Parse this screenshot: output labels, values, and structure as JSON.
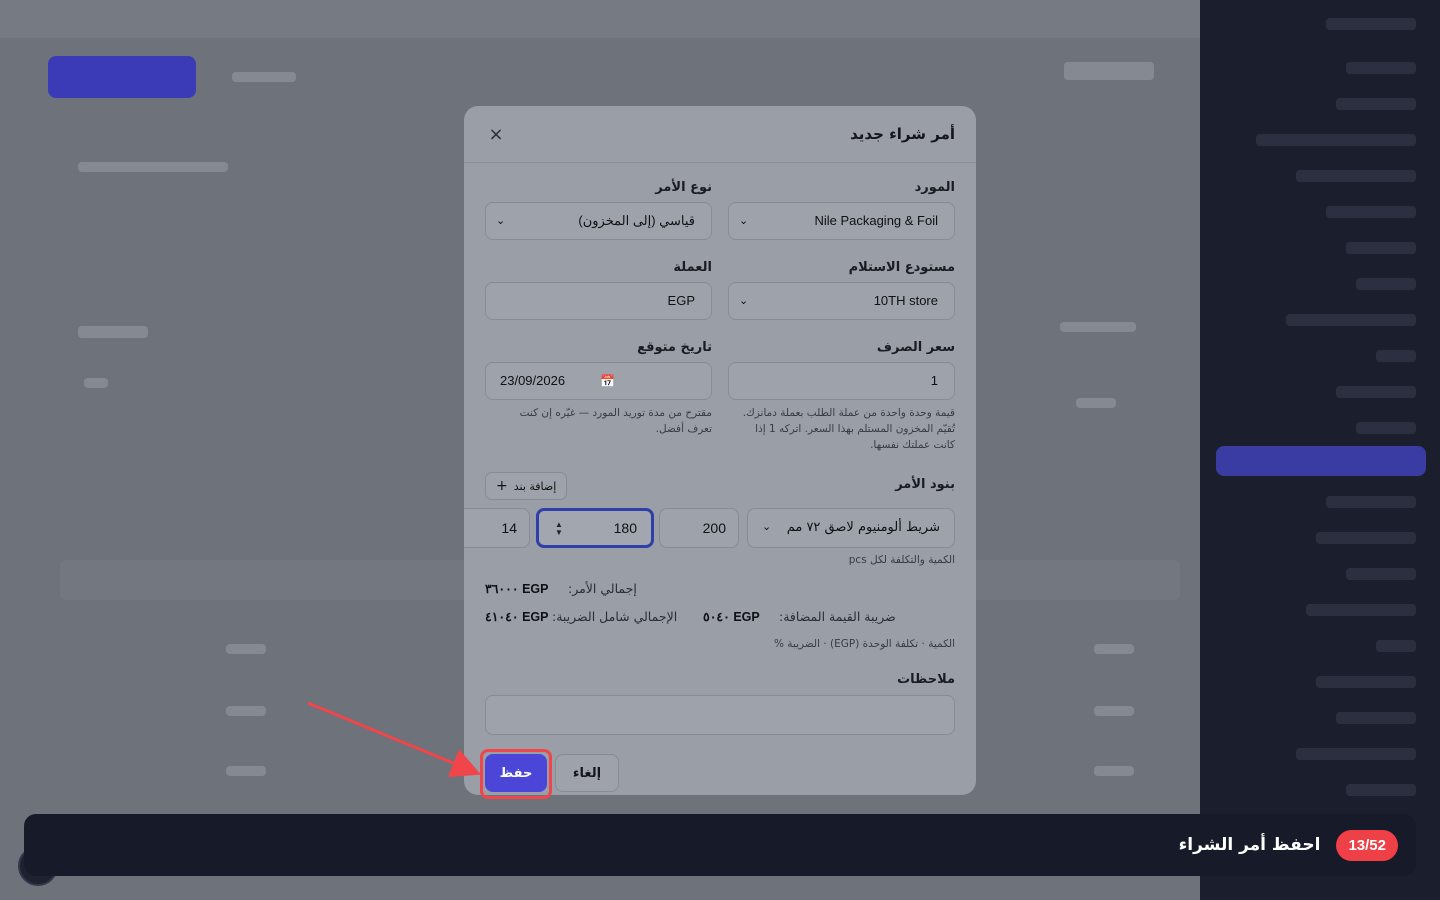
{
  "modal": {
    "title": "أمر شراء جديد",
    "close_symbol": "×",
    "supplier": {
      "label": "المورد",
      "value": "Nile Packaging & Foil"
    },
    "order_type": {
      "label": "نوع الأمر",
      "value": "قياسي (إلى المخزون)"
    },
    "receiving_warehouse": {
      "label": "مستودع الاستلام",
      "value": "10TH store"
    },
    "currency": {
      "label": "العملة",
      "value": "EGP"
    },
    "exchange_rate": {
      "label": "سعر الصرف",
      "value": "1",
      "hint": "قيمة وحدة واحدة من عملة الطلب بعملة دمانزك. تُقيّم المخزون المستلم بهذا السعر. اتركه 1 إذا كانت عملتك نفسها."
    },
    "expected_date": {
      "label": "تاريخ متوقع",
      "value": "23/09/2026",
      "hint": "مقترح من مدة توريد المورد — غيّره إن كنت تعرف أفضل."
    },
    "order_lines": {
      "label": "بنود الأمر",
      "add_button": "إضافة بند",
      "line": {
        "item": "شريط ألومنيوم لاصق ٧٢ مم",
        "quantity": "200",
        "unit_cost": "180",
        "tax": "14"
      },
      "line_hint": "الكمية والتكلفة لكل pcs"
    },
    "summary": {
      "order_total_label": "إجمالي الأمر:",
      "order_total_value": "EGP ٣٦٠٠٠",
      "vat_label": "ضريبة القيمة المضافة:",
      "vat_value": "EGP ٥٠٤٠",
      "grand_total_label": "الإجمالي شامل الضريبة:",
      "grand_total_value": "EGP ٤١٠٤٠",
      "columns_hint": "الكمية · تكلفة الوحدة (EGP) · الضريبة %"
    },
    "notes": {
      "label": "ملاحظات",
      "value": ""
    },
    "buttons": {
      "save": "حفظ",
      "cancel": "إلغاء"
    }
  },
  "tour": {
    "step": "13/52",
    "text": "احفظ أمر الشراء"
  },
  "colors": {
    "primary": "#4c46d8",
    "highlight": "#f0454a",
    "tour_bar": "#171a28",
    "sidebar": "#1b1e2c"
  }
}
